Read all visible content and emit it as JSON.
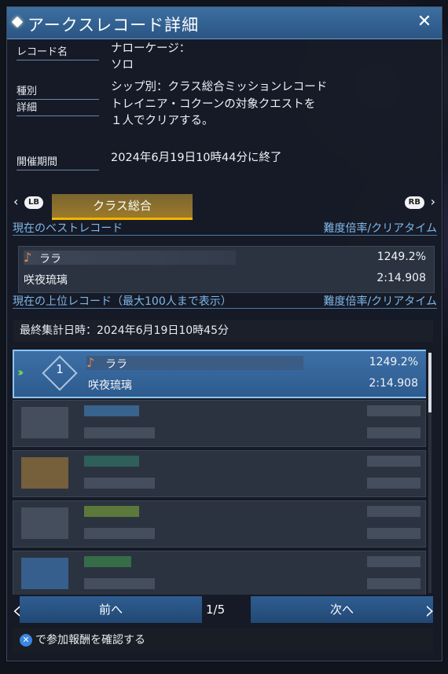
{
  "window": {
    "title": "アークスレコード詳細",
    "close_glyph": "✕"
  },
  "info": {
    "name_label": "レコード名",
    "name_value": "ナローケージ：\nソロ",
    "type_label": "種別",
    "type_value": "シップ別：クラス総合ミッションレコード",
    "detail_label": "詳細",
    "detail_value": "トレイニア・コクーンの対象クエストを\n１人でクリアする。",
    "period_label": "開催期間",
    "period_value": "2024年6月19日10時44分に終了"
  },
  "tabs": {
    "lb": "LB",
    "rb": "RB",
    "active": "クラス総合"
  },
  "best_section": {
    "title": "現在のベストレコード",
    "right": "難度倍率/クリアタイム"
  },
  "best": {
    "name": "ララ",
    "player": "咲夜琉璃",
    "rate": "1249.2%",
    "time": "2:14.908"
  },
  "top_section": {
    "title": "現在の上位レコード（最大100人まで表示）",
    "right": "難度倍率/クリアタイム"
  },
  "aggregate": "最終集計日時：2024年6月19日10時45分",
  "top_row": {
    "rank": "1",
    "name": "ララ",
    "player": "咲夜琉璃",
    "rate": "1249.2%",
    "time": "2:14.908"
  },
  "nav": {
    "prev": "前へ",
    "next": "次へ",
    "page": "1/5"
  },
  "footer": {
    "button_glyph": "✕",
    "text": "で参加報酬を確認する"
  },
  "colors": {
    "accent": "#f2b500",
    "header": "#2f5d91",
    "section": "#7fb6ea"
  }
}
